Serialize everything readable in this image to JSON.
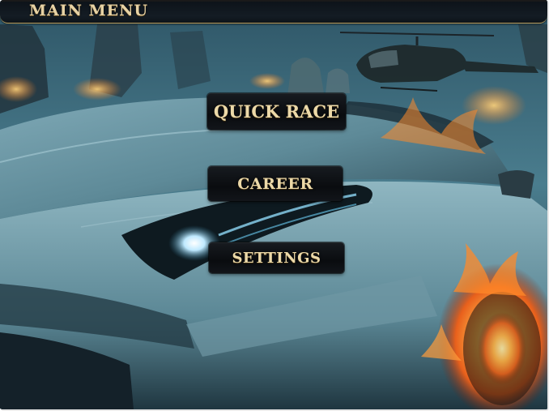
{
  "header": {
    "title": "MAIN MENU"
  },
  "menu": {
    "items": [
      {
        "label": "QUICK RACE"
      },
      {
        "label": "CAREER"
      },
      {
        "label": "SETTINGS"
      }
    ]
  },
  "colors": {
    "title_text": "#e7d2a4",
    "button_text": "#ecd9a8",
    "button_bg": "#0a0c0f",
    "title_border": "#b89a5a"
  },
  "icons": [
    "sports-car-artwork",
    "helicopter-artwork",
    "fire-artwork"
  ]
}
